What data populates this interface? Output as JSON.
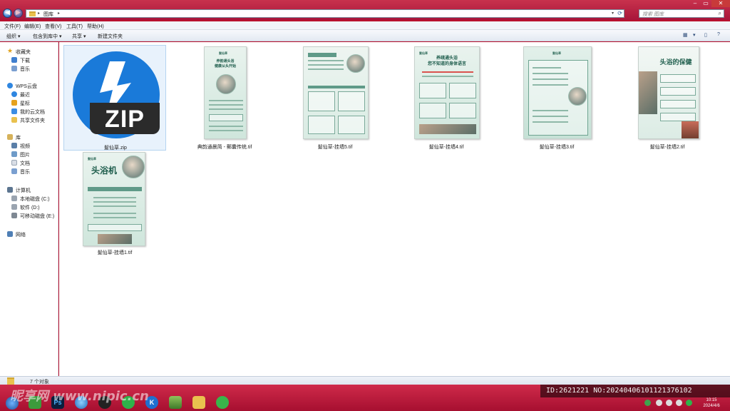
{
  "address": {
    "crumb": "图库",
    "search_placeholder": "搜索 图库"
  },
  "menu": [
    "文件(F)",
    "编辑(E)",
    "查看(V)",
    "工具(T)",
    "帮助(H)"
  ],
  "toolbar": {
    "organize": "组织 ▾",
    "include": "包含到库中 ▾",
    "share": "共享 ▾",
    "new_folder": "新建文件夹"
  },
  "nav": {
    "favorites": "收藏夹",
    "downloads": "下载",
    "music_fav": "音乐",
    "wps": "WPS云盘",
    "recent": "最近",
    "starred": "星标",
    "mycloud": "我的云文档",
    "shared": "共享文件夹",
    "library": "库",
    "videos": "视频",
    "pictures": "图片",
    "documents": "文档",
    "music": "音乐",
    "computer": "计算机",
    "drive_c": "本地磁盘 (C:)",
    "drive_d": "软件 (D:)",
    "drive_e": "可移动磁盘 (E:)",
    "network": "网络"
  },
  "files": [
    {
      "name": "髮仙草.zip"
    },
    {
      "name": "典韵通晨简 - 郵囊传统.tif",
      "poster_title": "养韵通头浴\n健康从头开始"
    },
    {
      "name": "髮仙草-挂墙5.tif"
    },
    {
      "name": "髮仙草-挂墙4.tif",
      "poster_title": "养疏通头浴\n您不知道的身体语言"
    },
    {
      "name": "髮仙草-挂墙3.tif"
    },
    {
      "name": "髮仙草-挂墙2.tif",
      "poster_title": "头浴的保健"
    },
    {
      "name": "髮仙草-挂墙1.tif",
      "poster_title": "头浴机"
    }
  ],
  "zip_label": "ZIP",
  "poster_logo": "髮仙草",
  "status": {
    "count": "7 个对象"
  },
  "watermark": "昵享网 www.nipic.cn",
  "id_text": "ID:2621221 NO:20240406101121376102",
  "clock": {
    "time": "10:15",
    "date": "2024/4/6"
  }
}
